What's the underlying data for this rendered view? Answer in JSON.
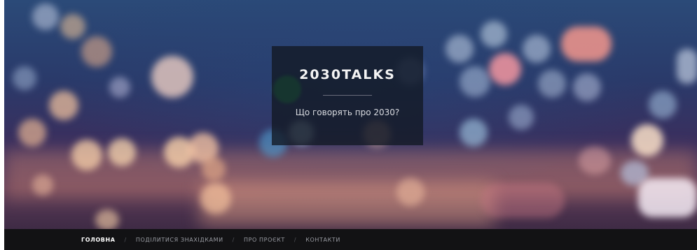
{
  "site": {
    "title": "2030TALKS",
    "tagline": "Що говорять про 2030?"
  },
  "nav": {
    "items": [
      {
        "label": "ГОЛОВНА",
        "active": true
      },
      {
        "label": "ПОДІЛИТИСЯ ЗНАХІДКАМИ",
        "active": false
      },
      {
        "label": "ПРО ПРОЄКТ",
        "active": false
      },
      {
        "label": "КОНТАКТИ",
        "active": false
      }
    ],
    "separator": "/"
  },
  "colors": {
    "nav_background": "#121214",
    "title_box": "#121822",
    "hero_sky": "#2b4a78",
    "hero_ground": "#5a3a58"
  }
}
